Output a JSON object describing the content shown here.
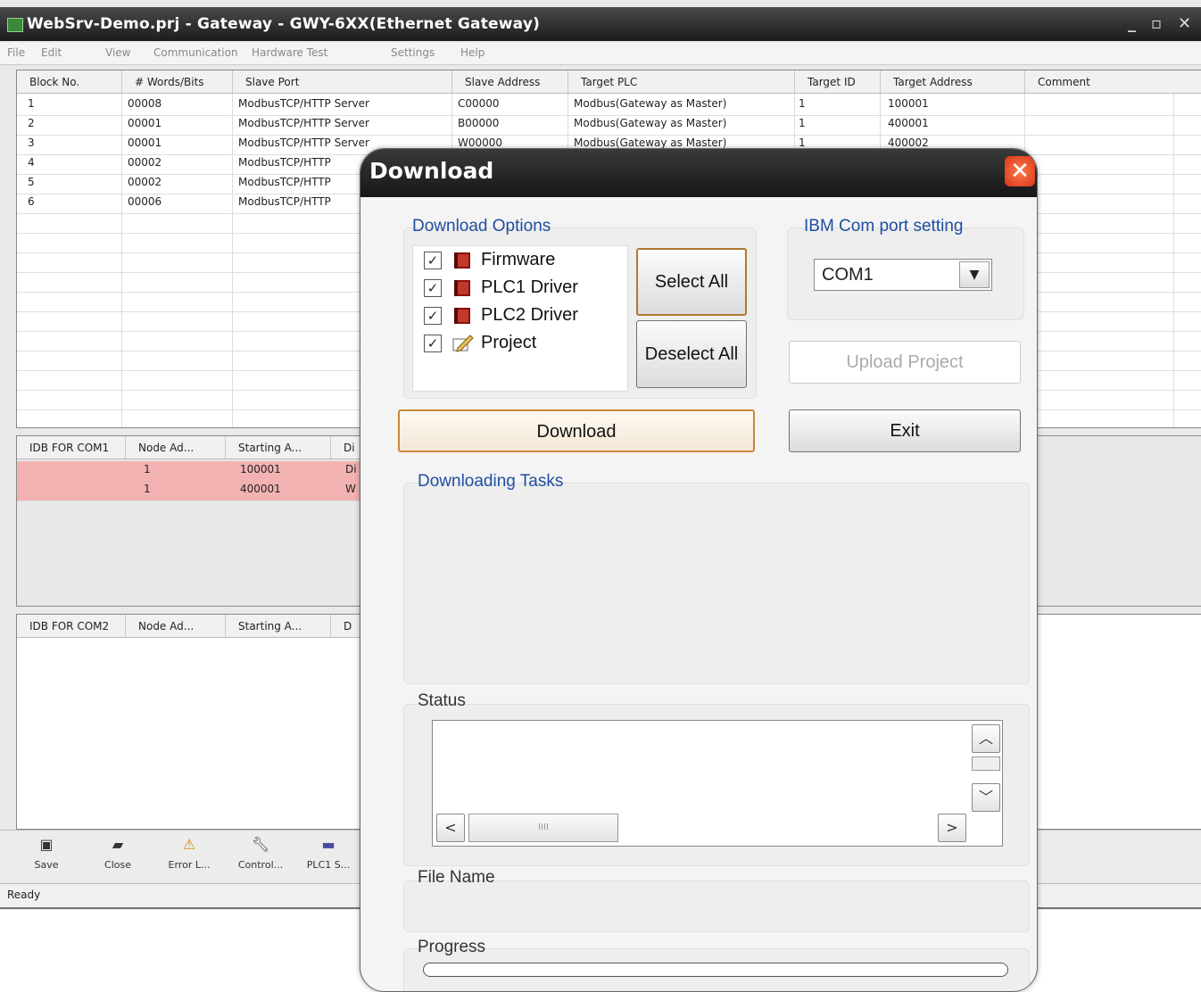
{
  "window": {
    "title": "WebSrv-Demo.prj - Gateway - GWY-6XX(Ethernet Gateway)",
    "min_glyph": "_",
    "max_glyph": "▫",
    "close_glyph": "✕"
  },
  "menu": [
    "File",
    "Edit",
    "View",
    "Communication",
    "Hardware Test",
    "Settings",
    "Help"
  ],
  "blocks_table": {
    "headers": [
      "Block No.",
      "# Words/Bits",
      "Slave Port",
      "Slave Address",
      "Target PLC",
      "Target ID",
      "Target Address",
      "Comment"
    ],
    "rows": [
      [
        "1",
        "00008",
        "ModbusTCP/HTTP Server",
        "C00000",
        "Modbus(Gateway as Master)",
        "1",
        "100001",
        ""
      ],
      [
        "2",
        "00001",
        "ModbusTCP/HTTP Server",
        "B00000",
        "Modbus(Gateway as Master)",
        "1",
        "400001",
        ""
      ],
      [
        "3",
        "00001",
        "ModbusTCP/HTTP Server",
        "W00000",
        "Modbus(Gateway as Master)",
        "1",
        "400002",
        ""
      ],
      [
        "4",
        "00002",
        "ModbusTCP/HTTP",
        "",
        "",
        "",
        "",
        ""
      ],
      [
        "5",
        "00002",
        "ModbusTCP/HTTP",
        "",
        "",
        "",
        "",
        ""
      ],
      [
        "6",
        "00006",
        "ModbusTCP/HTTP",
        "",
        "",
        "",
        "",
        ""
      ]
    ]
  },
  "com1_table": {
    "headers": [
      "IDB FOR COM1",
      "Node Ad...",
      "Starting A...",
      "Di"
    ],
    "rows": [
      [
        "",
        "1",
        "100001",
        "Di"
      ],
      [
        "",
        "1",
        "400001",
        "W"
      ]
    ]
  },
  "com2_table": {
    "headers": [
      "IDB FOR COM2",
      "Node Ad...",
      "Starting A...",
      "D"
    ]
  },
  "toolbar": [
    {
      "label": "Save",
      "icon": "save-icon"
    },
    {
      "label": "Close",
      "icon": "close-icon"
    },
    {
      "label": "Error L...",
      "icon": "warning-icon"
    },
    {
      "label": "Control...",
      "icon": "wrench-icon"
    },
    {
      "label": "PLC1 S...",
      "icon": "plc-icon"
    }
  ],
  "statusbar": {
    "text": "Ready"
  },
  "dialog": {
    "title": "Download",
    "options_label": "Download Options",
    "options": [
      {
        "label": "Firmware",
        "checked": true,
        "icon": "book-icon"
      },
      {
        "label": "PLC1 Driver",
        "checked": true,
        "icon": "book-icon"
      },
      {
        "label": "PLC2 Driver",
        "checked": true,
        "icon": "book-icon"
      },
      {
        "label": "Project",
        "checked": true,
        "icon": "pencil-doc-icon"
      }
    ],
    "select_all": "Select All",
    "deselect_all": "Deselect All",
    "com_setting_label": "IBM Com port setting",
    "com_port": "COM1",
    "upload_project": "Upload Project",
    "download_button": "Download",
    "exit_button": "Exit",
    "tasks_label": "Downloading Tasks",
    "status_label": "Status",
    "scroll_h_mark": "IIII",
    "file_name_label": "File Name",
    "progress_label": "Progress",
    "progress_fraction": 0
  }
}
